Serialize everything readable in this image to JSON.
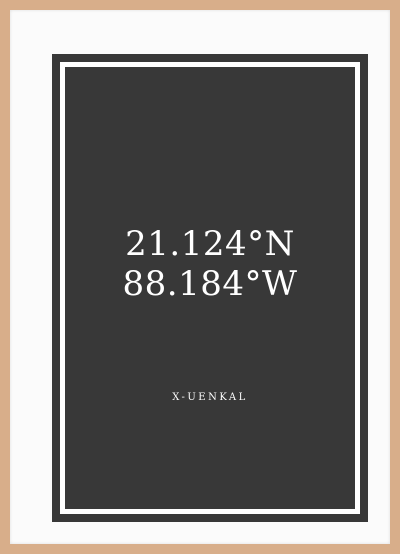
{
  "poster": {
    "latitude": "21.124°N",
    "longitude": "88.184°W",
    "caption": "X-UENKAL"
  },
  "colors": {
    "frame_wood": "#d8ae8a",
    "mat": "#fbfbfb",
    "print_background": "#383838",
    "text": "#ffffff"
  }
}
